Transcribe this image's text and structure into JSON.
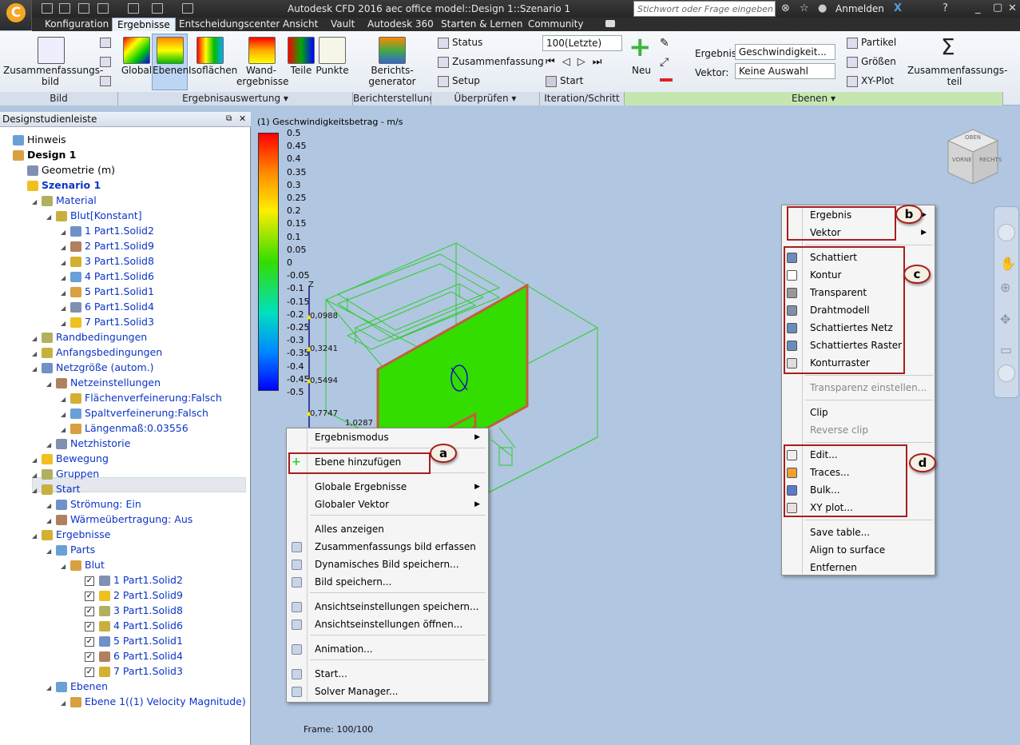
{
  "window": {
    "title": "Autodesk CFD 2016    aec office model::Design 1::Szenario 1"
  },
  "titlebar": {
    "search_placeholder": "Stichwort oder Frage eingeben",
    "signin": "Anmelden"
  },
  "tabs": [
    "Konfiguration",
    "Ergebnisse",
    "Entscheidungscenter",
    "Ansicht",
    "Vault",
    "Autodesk 360",
    "Starten & Lernen",
    "Community"
  ],
  "ribbon": {
    "bild": {
      "zusammenfassung": "Zusammenfassungs-\nbild",
      "panel": "Bild"
    },
    "auswertung": {
      "global": "Global",
      "ebenen": "Ebenen",
      "isoflaechen": "Isoflächen",
      "wand": "Wand-\nergebnisse",
      "teile": "Teile",
      "punkte": "Punkte",
      "panel": "Ergebnisauswertung ▾"
    },
    "bericht": {
      "generator": "Berichts-\ngenerator",
      "panel": "Berichterstellung"
    },
    "ueberpruefen": {
      "status": "Status",
      "zusammenfassung": "Zusammenfassung",
      "setup": "Setup",
      "panel": "Überprüfen ▾"
    },
    "iteration": {
      "value": "100(Letzte)",
      "start": "Start",
      "panel": "Iteration/Schritt"
    },
    "ebenen": {
      "neu": "Neu",
      "ergebnis_label": "Ergebnis:",
      "ergebnis_value": "Geschwindigkeit...",
      "vektor_label": "Vektor:",
      "vektor_value": "Keine Auswahl",
      "partikel": "Partikel",
      "groessen": "Größen",
      "xyplot": "XY-Plot",
      "zusammenfassungsteil": "Zusammenfassungs-\nteil",
      "panel": "Ebenen ▾"
    }
  },
  "panel": {
    "title": "Designstudienleiste",
    "tree": [
      {
        "label": "Hinweis",
        "indent": 0,
        "bold": false,
        "color": "black"
      },
      {
        "label": "Design 1",
        "indent": 0,
        "bold": true,
        "color": "black"
      },
      {
        "label": "Geometrie (m)",
        "indent": 1,
        "bold": false,
        "color": "black"
      },
      {
        "label": "Szenario 1",
        "indent": 1,
        "bold": true,
        "color": "blue"
      },
      {
        "label": "Material",
        "indent": 2,
        "bold": false,
        "color": "blue"
      },
      {
        "label": "Blut[Konstant]",
        "indent": 3,
        "bold": false,
        "color": "blue"
      },
      {
        "label": "1 Part1.Solid2",
        "indent": 4,
        "bold": false,
        "color": "blue"
      },
      {
        "label": "2 Part1.Solid9",
        "indent": 4,
        "bold": false,
        "color": "blue"
      },
      {
        "label": "3 Part1.Solid8",
        "indent": 4,
        "bold": false,
        "color": "blue"
      },
      {
        "label": "4 Part1.Solid6",
        "indent": 4,
        "bold": false,
        "color": "blue"
      },
      {
        "label": "5 Part1.Solid1",
        "indent": 4,
        "bold": false,
        "color": "blue"
      },
      {
        "label": "6 Part1.Solid4",
        "indent": 4,
        "bold": false,
        "color": "blue"
      },
      {
        "label": "7 Part1.Solid3",
        "indent": 4,
        "bold": false,
        "color": "blue"
      },
      {
        "label": "Randbedingungen",
        "indent": 2,
        "bold": false,
        "color": "blue"
      },
      {
        "label": "Anfangsbedingungen",
        "indent": 2,
        "bold": false,
        "color": "blue"
      },
      {
        "label": "Netzgröße (autom.)",
        "indent": 2,
        "bold": false,
        "color": "blue"
      },
      {
        "label": "Netzeinstellungen",
        "indent": 3,
        "bold": false,
        "color": "blue"
      },
      {
        "label": "Flächenverfeinerung:Falsch",
        "indent": 4,
        "bold": false,
        "color": "blue"
      },
      {
        "label": "Spaltverfeinerung:Falsch",
        "indent": 4,
        "bold": false,
        "color": "blue"
      },
      {
        "label": "Längenmaß:0.03556",
        "indent": 4,
        "bold": false,
        "color": "blue"
      },
      {
        "label": "Netzhistorie",
        "indent": 3,
        "bold": false,
        "color": "blue"
      },
      {
        "label": "Bewegung",
        "indent": 2,
        "bold": false,
        "color": "blue"
      },
      {
        "label": "Gruppen",
        "indent": 2,
        "bold": false,
        "color": "blue"
      },
      {
        "label": "Start",
        "indent": 2,
        "bold": false,
        "color": "blue"
      },
      {
        "label": "Strömung: Ein",
        "indent": 3,
        "bold": false,
        "color": "blue"
      },
      {
        "label": "Wärmeübertragung: Aus",
        "indent": 3,
        "bold": false,
        "color": "blue"
      },
      {
        "label": "Ergebnisse",
        "indent": 2,
        "bold": false,
        "color": "blue"
      },
      {
        "label": "Parts",
        "indent": 3,
        "bold": false,
        "color": "blue"
      },
      {
        "label": "Blut",
        "indent": 4,
        "bold": false,
        "color": "blue"
      },
      {
        "label": "1 Part1.Solid2",
        "indent": 5,
        "bold": false,
        "color": "blue",
        "checked": true
      },
      {
        "label": "2 Part1.Solid9",
        "indent": 5,
        "bold": false,
        "color": "blue",
        "checked": true
      },
      {
        "label": "3 Part1.Solid8",
        "indent": 5,
        "bold": false,
        "color": "blue",
        "checked": true
      },
      {
        "label": "4 Part1.Solid6",
        "indent": 5,
        "bold": false,
        "color": "blue",
        "checked": true
      },
      {
        "label": "5 Part1.Solid1",
        "indent": 5,
        "bold": false,
        "color": "blue",
        "checked": true
      },
      {
        "label": "6 Part1.Solid4",
        "indent": 5,
        "bold": false,
        "color": "blue",
        "checked": true
      },
      {
        "label": "7 Part1.Solid3",
        "indent": 5,
        "bold": false,
        "color": "blue",
        "checked": true
      },
      {
        "label": "Ebenen",
        "indent": 3,
        "bold": false,
        "color": "blue"
      },
      {
        "label": "Ebene 1((1) Velocity Magnitude)",
        "indent": 4,
        "bold": false,
        "color": "blue"
      }
    ]
  },
  "viewport": {
    "legend_title": "(1) Geschwindigkeitsbetrag - m/s",
    "legend_values": [
      "0.5",
      "0.45",
      "0.4",
      "0.35",
      "0.3",
      "0.25",
      "0.2",
      "0.15",
      "0.1",
      "0.05",
      "0",
      "-0.05",
      "-0.1",
      "-0.15",
      "-0.2",
      "-0.25",
      "-0.3",
      "-0.35",
      "-0.4",
      "-0.45",
      "-0.5"
    ],
    "axis_label": "Z",
    "ruler_values": [
      "0,0988",
      "0,3241",
      "0,5494",
      "0,7747",
      "1,0287"
    ],
    "frame": "Frame: 100/100",
    "viewcube": {
      "top": "OBEN",
      "front": "VORNE",
      "right": "RECHTS"
    }
  },
  "menu_left": {
    "items": [
      {
        "label": "Ergebnismodus",
        "sub": true
      },
      {
        "label": "Ebene hinzufügen",
        "icon": "plus"
      },
      {
        "label": "Globale Ergebnisse",
        "sub": true
      },
      {
        "label": "Globaler Vektor",
        "sub": true
      },
      {
        "label": "Alles anzeigen"
      },
      {
        "label": "Zusammenfassungs bild erfassen"
      },
      {
        "label": "Dynamisches Bild speichern..."
      },
      {
        "label": "Bild speichern..."
      },
      {
        "label": "Ansichtseinstellungen speichern..."
      },
      {
        "label": "Ansichtseinstellungen öffnen..."
      },
      {
        "label": "Animation..."
      },
      {
        "label": "Start..."
      },
      {
        "label": "Solver Manager..."
      }
    ]
  },
  "menu_right": {
    "items": [
      {
        "label": "Ergebnis",
        "sub": true
      },
      {
        "label": "Vektor",
        "sub": true
      },
      {
        "label": "Schattiert"
      },
      {
        "label": "Kontur"
      },
      {
        "label": "Transparent"
      },
      {
        "label": "Drahtmodell"
      },
      {
        "label": "Schattiertes Netz"
      },
      {
        "label": "Schattiertes Raster"
      },
      {
        "label": "Konturraster"
      },
      {
        "label": "Transparenz einstellen...",
        "disabled": true
      },
      {
        "label": "Clip"
      },
      {
        "label": "Reverse clip",
        "disabled": true
      },
      {
        "label": "Edit..."
      },
      {
        "label": "Traces..."
      },
      {
        "label": "Bulk..."
      },
      {
        "label": "XY plot..."
      },
      {
        "label": "Save table..."
      },
      {
        "label": "Align to surface"
      },
      {
        "label": "Entfernen"
      }
    ]
  },
  "callouts": {
    "a": "a",
    "b": "b",
    "c": "c",
    "d": "d"
  },
  "colors": {
    "accent": "#a81e1e",
    "tree_blue": "#0b34c7",
    "viewport_bg": "#b1c6e0",
    "plane_green": "#33dd00"
  }
}
